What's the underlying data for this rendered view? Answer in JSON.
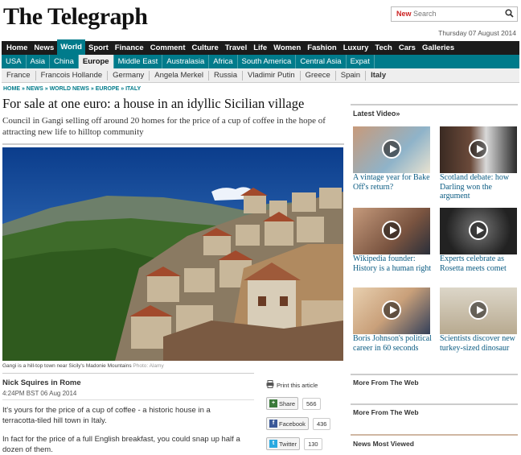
{
  "header": {
    "logo": "The Telegraph",
    "search_new": "New",
    "search_placeholder": "Search",
    "date": "Thursday 07 August 2014"
  },
  "nav_primary": [
    "Home",
    "News",
    "World",
    "Sport",
    "Finance",
    "Comment",
    "Culture",
    "Travel",
    "Life",
    "Women",
    "Fashion",
    "Luxury",
    "Tech",
    "Cars",
    "Galleries"
  ],
  "nav_primary_active": "World",
  "nav_secondary": [
    "USA",
    "Asia",
    "China",
    "Europe",
    "Middle East",
    "Australasia",
    "Africa",
    "South America",
    "Central Asia",
    "Expat"
  ],
  "nav_secondary_active": "Europe",
  "nav_tertiary": [
    "France",
    "Francois Hollande",
    "Germany",
    "Angela Merkel",
    "Russia",
    "Vladimir Putin",
    "Greece",
    "Spain",
    "Italy"
  ],
  "nav_tertiary_active": "Italy",
  "breadcrumb": "HOME » NEWS » WORLD NEWS » EUROPE » ITALY",
  "article": {
    "headline": "For sale at one euro: a house in an idyllic Sicilian village",
    "standfirst": "Council in Gangi selling off around 20 homes for the price of a cup of coffee in the hope of attracting new life to hilltop community",
    "caption": "Gangi is a hill-top town near Sicily's Madonie Mountains",
    "photo_credit": "Photo: Alamy",
    "author": "Nick Squires in Rome",
    "timestamp": "4:24PM BST 06 Aug 2014",
    "para1": "It's yours for the price of a cup of coffee - a historic house in a terracotta-tiled hill town in Italy.",
    "para2": "In fact for the price of a full English breakfast, you could snap up half a dozen of them."
  },
  "share": {
    "print": "Print this article",
    "share_label": "Share",
    "share_count": "566",
    "facebook_label": "Facebook",
    "facebook_count": "436",
    "twitter_label": "Twitter",
    "twitter_count": "130"
  },
  "sidebar": {
    "latest_video": "Latest Video»",
    "videos": [
      {
        "title": "A vintage year for Bake Off's return?"
      },
      {
        "title": "Scotland debate: how Darling won the argument"
      },
      {
        "title": "Wikipedia founder: History is a human right"
      },
      {
        "title": "Experts celebrate as Rosetta meets comet"
      },
      {
        "title": "Boris Johnson's political career in 60 seconds"
      },
      {
        "title": "Scientists discover new turkey-sized dinosaur"
      }
    ],
    "more_web_1": "More From The Web",
    "more_web_2": "More From The Web",
    "news_most_viewed": "News Most Viewed"
  },
  "colors": {
    "brand_teal": "#007b8b",
    "nav_black": "#1b1b1b",
    "link_blue": "#0a5b82"
  }
}
